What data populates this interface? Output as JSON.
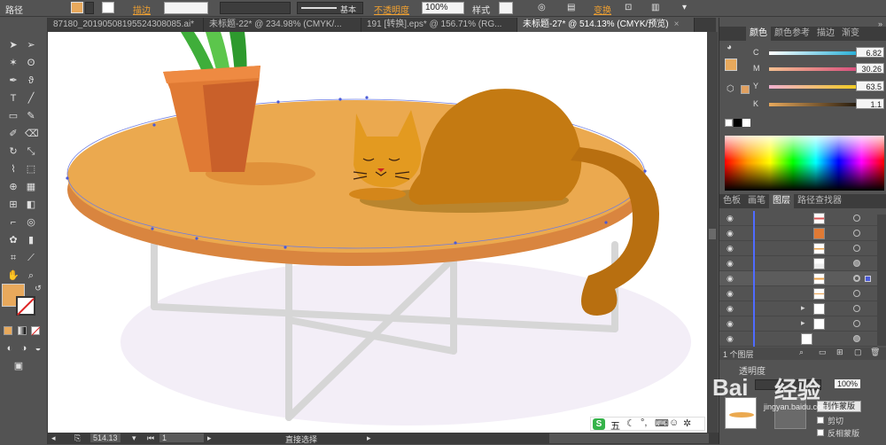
{
  "controlbar": {
    "path_label": "路径",
    "stroke_label": "描边",
    "stroke_style": "基本",
    "opacity_label": "不透明度",
    "opacity_value": "100%",
    "style_label": "样式",
    "transform_label": "变换"
  },
  "tabs": [
    {
      "label": "87180_20190508195524308085.ai*",
      "active": false
    },
    {
      "label": "未标题-22* @ 234.98% (CMYK/...",
      "active": false
    },
    {
      "label": "191 [转换].eps* @ 156.71% (RG...",
      "active": false
    },
    {
      "label": "未标题-27* @ 514.13% (CMYK/预览)",
      "active": true
    }
  ],
  "color_panel": {
    "tabs": [
      "颜色",
      "颜色参考",
      "描边",
      "渐变"
    ],
    "channels": [
      {
        "name": "C",
        "value": "6.82"
      },
      {
        "name": "M",
        "value": "30.26"
      },
      {
        "name": "Y",
        "value": "63.5"
      },
      {
        "name": "K",
        "value": "1.1"
      }
    ],
    "fill_color": "#e8a95c",
    "small_swatch": "#e0a060"
  },
  "layers_panel": {
    "tabs": [
      "色板",
      "画笔",
      "图层",
      "路径查找器"
    ],
    "footer_count": "1 个图层",
    "rows": 9
  },
  "transparency_panel": {
    "title": "透明度",
    "mode_value": "100%",
    "make_mask_label": "制作蒙版",
    "clip_label": "剪切",
    "invert_label": "反相蒙版"
  },
  "status": {
    "zoom": "514.13",
    "page": "1",
    "tool_name": "直接选择"
  },
  "ime_bar": {
    "mode": "五"
  },
  "watermark": {
    "text": "经验",
    "domain": "jingyan.baidu.com"
  },
  "palette": {
    "tabletop": "#eba94f",
    "table_edge": "#d9853f",
    "shadow": "#f3eef8",
    "legs": "#d4d4d4",
    "pot": "#e07a34",
    "plant": "#3fae3a",
    "cat": "#c47a12"
  }
}
